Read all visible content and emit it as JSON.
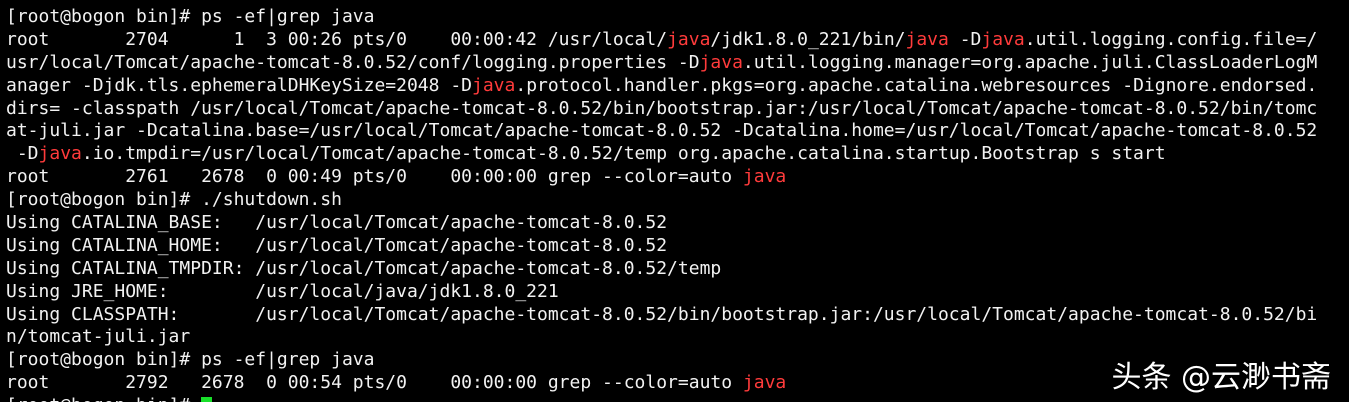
{
  "terminal": {
    "lines": [
      [
        {
          "t": "[root@bogon bin]# ps -ef|grep java"
        }
      ],
      [
        {
          "t": "root       2704      1  3 00:26 pts/0    00:00:42 /usr/local/"
        },
        {
          "t": "java",
          "hl": true
        },
        {
          "t": "/jdk1.8.0_221/bin/"
        },
        {
          "t": "java",
          "hl": true
        },
        {
          "t": " -D"
        },
        {
          "t": "java",
          "hl": true
        },
        {
          "t": ".util.logging.config.file=/"
        }
      ],
      [
        {
          "t": "usr/local/Tomcat/apache-tomcat-8.0.52/conf/logging.properties -D"
        },
        {
          "t": "java",
          "hl": true
        },
        {
          "t": ".util.logging.manager=org.apache.juli.ClassLoaderLogM"
        }
      ],
      [
        {
          "t": "anager -Djdk.tls.ephemeralDHKeySize=2048 -D"
        },
        {
          "t": "java",
          "hl": true
        },
        {
          "t": ".protocol.handler.pkgs=org.apache.catalina.webresources -Dignore.endorsed."
        }
      ],
      [
        {
          "t": "dirs= -classpath /usr/local/Tomcat/apache-tomcat-8.0.52/bin/bootstrap.jar:/usr/local/Tomcat/apache-tomcat-8.0.52/bin/tomc"
        }
      ],
      [
        {
          "t": "at-juli.jar -Dcatalina.base=/usr/local/Tomcat/apache-tomcat-8.0.52 -Dcatalina.home=/usr/local/Tomcat/apache-tomcat-8.0.52"
        }
      ],
      [
        {
          "t": " -D"
        },
        {
          "t": "java",
          "hl": true
        },
        {
          "t": ".io.tmpdir=/usr/local/Tomcat/apache-tomcat-8.0.52/temp org.apache.catalina.startup.Bootstrap s start"
        }
      ],
      [
        {
          "t": "root       2761   2678  0 00:49 pts/0    00:00:00 grep --color=auto "
        },
        {
          "t": "java",
          "hl": true
        }
      ],
      [
        {
          "t": "[root@bogon bin]# ./shutdown.sh"
        }
      ],
      [
        {
          "t": "Using CATALINA_BASE:   /usr/local/Tomcat/apache-tomcat-8.0.52"
        }
      ],
      [
        {
          "t": "Using CATALINA_HOME:   /usr/local/Tomcat/apache-tomcat-8.0.52"
        }
      ],
      [
        {
          "t": "Using CATALINA_TMPDIR: /usr/local/Tomcat/apache-tomcat-8.0.52/temp"
        }
      ],
      [
        {
          "t": "Using JRE_HOME:        /usr/local/java/jdk1.8.0_221"
        }
      ],
      [
        {
          "t": "Using CLASSPATH:       /usr/local/Tomcat/apache-tomcat-8.0.52/bin/bootstrap.jar:/usr/local/Tomcat/apache-tomcat-8.0.52/bi"
        }
      ],
      [
        {
          "t": "n/tomcat-juli.jar"
        }
      ],
      [
        {
          "t": "[root@bogon bin]# ps -ef|grep java"
        }
      ],
      [
        {
          "t": "root       2792   2678  0 00:54 pts/0    00:00:00 grep --color=auto "
        },
        {
          "t": "java",
          "hl": true
        }
      ],
      [
        {
          "t": "[root@bogon bin]# "
        },
        {
          "cursor": true
        }
      ]
    ]
  },
  "watermark": {
    "text": "头条 @云渺书斋"
  },
  "colors": {
    "background": "#000000",
    "text": "#f2f2f2",
    "highlight": "#ff3b3b",
    "cursor": "#18e02a"
  }
}
